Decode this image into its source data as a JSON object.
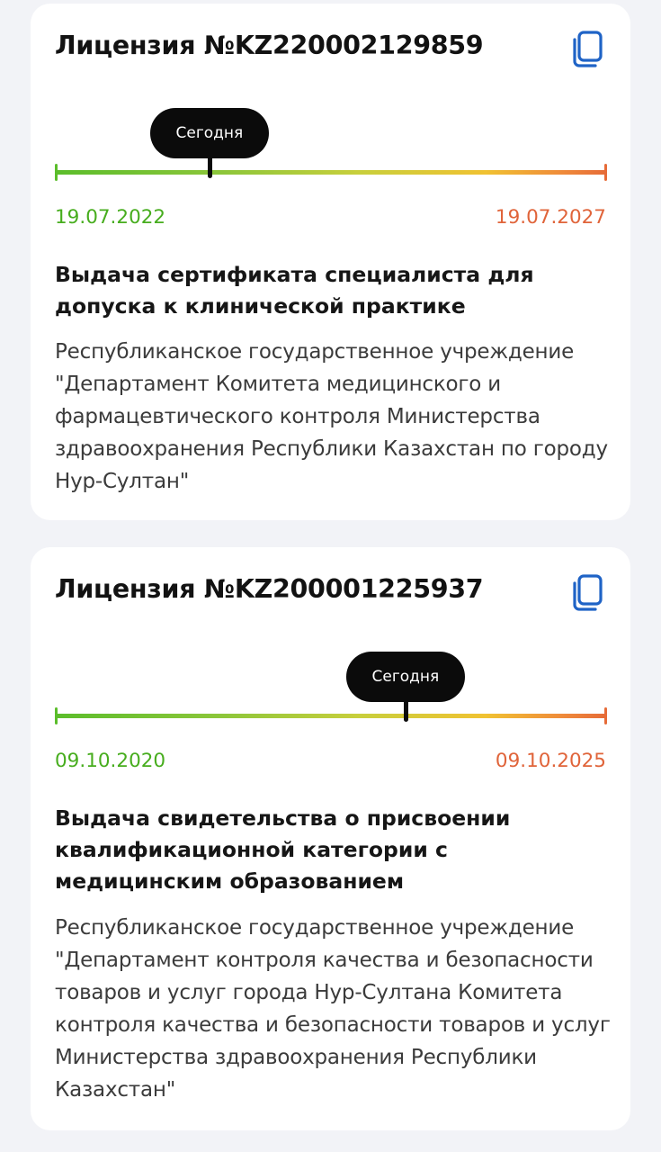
{
  "licenses": [
    {
      "title": "Лицензия №KZ22000212985​9",
      "today_label": "Сегодня",
      "today_progress": 0.28,
      "start_date": "19.07.2022",
      "end_date": "19.07.2027",
      "service": "Выдача сертификата специалиста для допуска к клинической практике",
      "organization": "Республиканское государственное учреждение \"Департамент Комитета медицинского и фармацевтического контроля Министерства здравоохранения Республики Казахстан по городу Нур-Султан\""
    },
    {
      "title": "Лицензия №KZ200001225937",
      "today_label": "Сегодня",
      "today_progress": 0.635,
      "start_date": "09.10.2020",
      "end_date": "09.10.2025",
      "service": "Выдача свидетельства о присвоении квалификационной категории с медицинским образованием",
      "organization": "Республиканское государственное учреждение \"Департамент контроля качества и безопасности товаров и услуг города Нур-Султана Комитета контроля качества и безопасности товаров и услуг Министерства здравоохранения Республики Казахстан\""
    }
  ],
  "icons": {
    "copy": "copy-icon"
  },
  "colors": {
    "accent": "#1f63c6",
    "start_date": "#47ad1e",
    "end_date": "#e0643a",
    "marker": "#0b0b0b"
  }
}
